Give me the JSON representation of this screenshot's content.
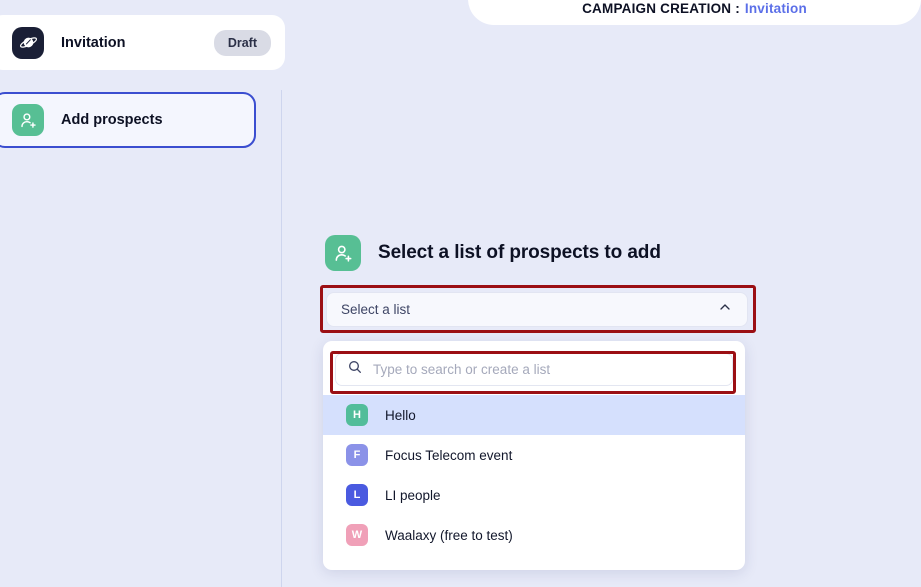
{
  "header": {
    "label": "CAMPAIGN CREATION :",
    "value": "Invitation"
  },
  "sidebar": {
    "campaign": {
      "icon": "planet-icon",
      "name": "Invitation",
      "status": "Draft"
    },
    "step": {
      "icon": "add-person-icon",
      "name": "Add prospects"
    }
  },
  "main": {
    "heading": {
      "icon": "add-person-icon",
      "text": "Select a list of prospects to add"
    },
    "select": {
      "value": "Select a list",
      "chevron": "chevron-up-icon"
    },
    "search": {
      "icon": "search-icon",
      "placeholder": "Type to search or create a list"
    },
    "lists": [
      {
        "initial": "H",
        "label": "Hello",
        "color": "#52bd9a",
        "selected": true
      },
      {
        "initial": "F",
        "label": "Focus Telecom event",
        "color": "#8b92e8",
        "selected": false
      },
      {
        "initial": "L",
        "label": "LI people",
        "color": "#4a5ae0",
        "selected": false
      },
      {
        "initial": "W",
        "label": "Waalaxy (free to test)",
        "color": "#f0a0b8",
        "selected": false
      }
    ]
  },
  "annotations": {
    "color": "#9b0f14",
    "targets": [
      "select-a-list-combobox",
      "search-or-create-list-input"
    ]
  },
  "theme": {
    "page_background": "#e7eaf8",
    "accent_blue": "#3b4ed0",
    "accent_green": "#57bf94",
    "link_blue": "#5b6fe8",
    "selected_row": "#d5e0fd"
  }
}
